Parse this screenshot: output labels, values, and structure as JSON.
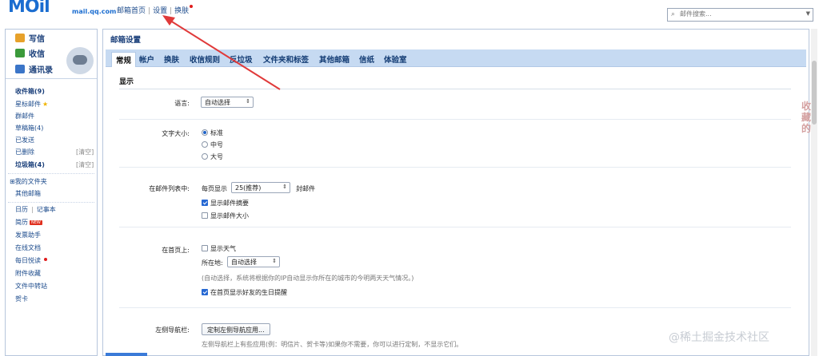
{
  "header": {
    "logo_text": "MOil",
    "logo_sub": "mail.qq.com",
    "links": [
      "邮箱首页",
      "设置",
      "换肤"
    ],
    "search_placeholder": "邮件搜索..."
  },
  "sidebar": {
    "quick": [
      {
        "label": "写信",
        "icon": "compose-icon",
        "color": "#e7a12a"
      },
      {
        "label": "收信",
        "icon": "inbox-icon",
        "color": "#3b9a3b"
      },
      {
        "label": "通讯录",
        "icon": "contacts-icon",
        "color": "#3b75c8"
      }
    ],
    "folders": [
      {
        "label": "收件箱(9)",
        "bold": true
      },
      {
        "label": "星标邮件",
        "star": true
      },
      {
        "label": "群邮件"
      },
      {
        "label": "草稿箱(4)"
      },
      {
        "label": "已发送"
      },
      {
        "label": "已删除",
        "action": "[清空]"
      },
      {
        "label": "垃圾箱(4)",
        "bold": true,
        "action": "[清空]"
      }
    ],
    "myfolders": {
      "label": "我的文件夹",
      "toggle": "⊞"
    },
    "other": "其他邮箱",
    "apps": [
      {
        "label": "日历",
        "extra": "记事本"
      },
      {
        "label": "简历",
        "badge": "NEW"
      },
      {
        "label": "发票助手"
      },
      {
        "label": "在线文档"
      },
      {
        "label": "每日悦读",
        "dot": true
      },
      {
        "label": "附件收藏"
      },
      {
        "label": "文件中转站"
      },
      {
        "label": "贺卡"
      }
    ]
  },
  "main": {
    "title": "邮箱设置",
    "tabs": [
      "常规",
      "帐户",
      "换肤",
      "收信规则",
      "反垃圾",
      "文件夹和标签",
      "其他邮箱",
      "信纸",
      "体验室"
    ],
    "active_tab": 0,
    "section": "显示",
    "language": {
      "label": "语言:",
      "value": "自动选择"
    },
    "fontsize": {
      "label": "文字大小:",
      "options": [
        "标准",
        "中号",
        "大号"
      ],
      "selected": 0
    },
    "maillist": {
      "label": "在邮件列表中:",
      "prefix": "每页显示",
      "value": "25(推荐)",
      "suffix": "封邮件",
      "show_summary": "显示邮件摘要",
      "show_summary_checked": true,
      "show_size": "显示邮件大小",
      "show_size_checked": false
    },
    "homepage": {
      "label": "在首页上:",
      "weather": "显示天气",
      "weather_checked": false,
      "location_label": "所在地:",
      "location_value": "自动选择",
      "note": "(自动选择，系统将根据你的IP自动显示你所在的城市的今明两天天气情况。)",
      "birthday": "在首页显示好友的生日提醒",
      "birthday_checked": true
    },
    "leftnav": {
      "label": "左侧导航栏:",
      "button": "定制左侧导航应用...",
      "note": "左侧导航栏上有些应用(例：明信片、贺卡等)如果你不需要，你可以进行定制，不显示它们。"
    }
  },
  "side_tag": "收藏的",
  "watermark": "@稀土掘金技术社区",
  "annotation_color": "#e03a3a"
}
